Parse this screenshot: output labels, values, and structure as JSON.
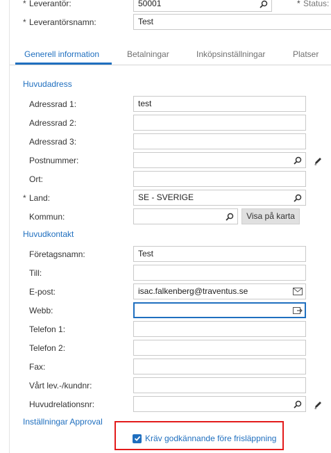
{
  "header": {
    "supplier_label": "Leverantör:",
    "supplier_value": "50001",
    "status_label": "Status:",
    "supplier_name_label": "Leverantörsnamn:",
    "supplier_name_value": "Test",
    "required_mark": "*"
  },
  "tabs": [
    {
      "label": "Generell information",
      "active": true
    },
    {
      "label": "Betalningar",
      "active": false
    },
    {
      "label": "Inköpsinställningar",
      "active": false
    },
    {
      "label": "Platser",
      "active": false
    }
  ],
  "main_address": {
    "title": "Huvudadress",
    "fields": {
      "addr1": {
        "label": "Adressrad 1:",
        "value": "test"
      },
      "addr2": {
        "label": "Adressrad 2:",
        "value": ""
      },
      "addr3": {
        "label": "Adressrad 3:",
        "value": ""
      },
      "postal": {
        "label": "Postnummer:",
        "value": ""
      },
      "city": {
        "label": "Ort:",
        "value": ""
      },
      "country": {
        "label": "Land:",
        "value": "SE - SVERIGE"
      },
      "municipality": {
        "label": "Kommun:",
        "value": ""
      }
    },
    "map_button": "Visa på karta"
  },
  "main_contact": {
    "title": "Huvudkontakt",
    "fields": {
      "company": {
        "label": "Företagsnamn:",
        "value": "Test"
      },
      "attention": {
        "label": "Till:",
        "value": ""
      },
      "email": {
        "label": "E-post:",
        "value": "isac.falkenberg@traventus.se"
      },
      "web": {
        "label": "Webb:",
        "value": ""
      },
      "phone1": {
        "label": "Telefon 1:",
        "value": ""
      },
      "phone2": {
        "label": "Telefon 2:",
        "value": ""
      },
      "fax": {
        "label": "Fax:",
        "value": ""
      },
      "account_no": {
        "label": "Vårt lev.-/kundnr:",
        "value": ""
      },
      "relation": {
        "label": "Huvudrelationsnr:",
        "value": ""
      }
    }
  },
  "approval": {
    "title": "Inställningar Approval",
    "require_approval_label": "Kräv godkännande före frisläppning",
    "require_approval_checked": true
  },
  "colors": {
    "accent": "#1f6fbf",
    "highlight": "#e31a1a"
  },
  "icons": [
    "search-icon",
    "pencil-icon",
    "mail-icon",
    "open-link-icon",
    "checkmark-icon"
  ]
}
